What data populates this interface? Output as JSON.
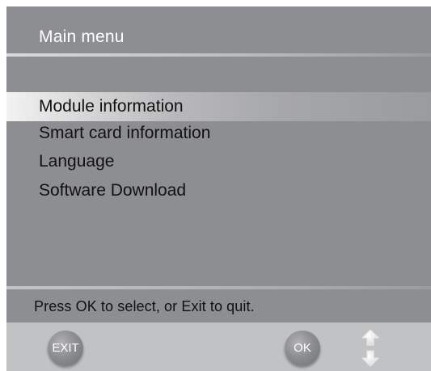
{
  "header": {
    "title": "Main menu"
  },
  "menu": {
    "items": [
      {
        "label": "Module information",
        "selected": true
      },
      {
        "label": "Smart card information",
        "selected": false
      },
      {
        "label": "Language",
        "selected": false
      },
      {
        "label": "Software Download",
        "selected": false
      }
    ]
  },
  "hint": {
    "text": "Press OK to select, or Exit to quit."
  },
  "footer": {
    "exit_label": "EXIT",
    "ok_label": "OK",
    "up_icon": "arrow-up-icon",
    "down_icon": "arrow-down-icon"
  },
  "colors": {
    "background": "#8d8e91",
    "footer": "#c1c2c4",
    "highlight": "#dcdcdd",
    "title_text": "#ffffff",
    "menu_text": "#111111"
  }
}
